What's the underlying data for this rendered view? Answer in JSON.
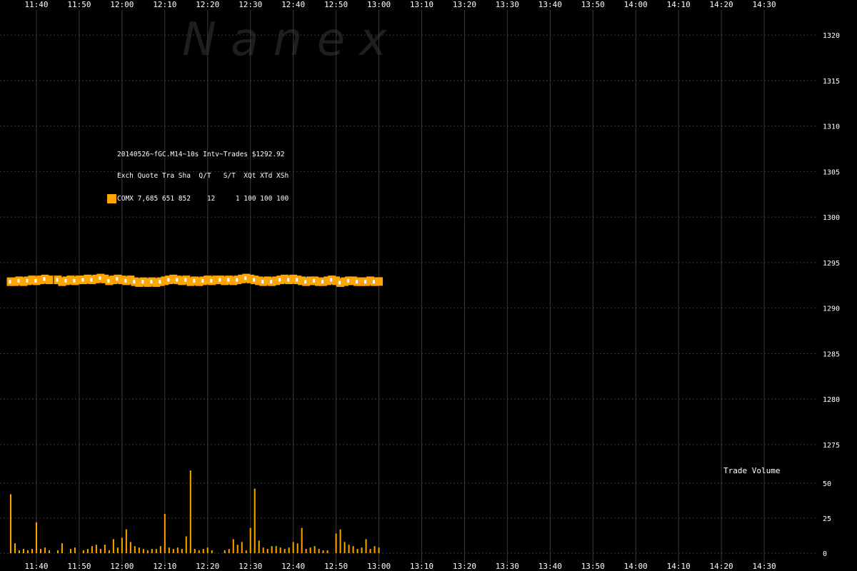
{
  "watermark": "N  a  n  e  x",
  "legend": {
    "line1": "20140526~fGC.M14~10s Intv~Trades $1292.92",
    "line2": "Exch Quote Tra Sha  Q/T   S/T  XQt XTd XSh",
    "line3": "COMX 7,685 651 852    12     1 100 100 100",
    "swatch_color": "#FFA500"
  },
  "volume_label": "Trade Volume",
  "colors": {
    "background": "#000000",
    "grid": "#3a3a3a",
    "price": "#FFA500",
    "price_marker": "#FFFFFF",
    "volume": "#FFA500"
  },
  "chart_data": [
    {
      "type": "scatter",
      "title": "",
      "x_ticks": [
        "11:40",
        "11:50",
        "12:00",
        "12:10",
        "12:20",
        "12:30",
        "12:40",
        "12:50",
        "13:00",
        "13:10",
        "13:20",
        "13:30",
        "13:40",
        "13:50",
        "14:00",
        "14:10",
        "14:20",
        "14:30"
      ],
      "x_range": [
        "11:34",
        "14:36"
      ],
      "y_ticks": [
        1275,
        1280,
        1285,
        1290,
        1295,
        1300,
        1305,
        1310,
        1315,
        1320
      ],
      "y_range": [
        1273.5,
        1321.5
      ],
      "grid": true,
      "series": [
        {
          "name": "COMX",
          "points": [
            [
              "11:34",
              1292.9
            ],
            [
              "11:35",
              1292.9
            ],
            [
              "11:36",
              1293.0
            ],
            [
              "11:37",
              1292.9
            ],
            [
              "11:38",
              1293.0
            ],
            [
              "11:39",
              1293.1
            ],
            [
              "11:40",
              1293.0
            ],
            [
              "11:41",
              1293.1
            ],
            [
              "11:42",
              1293.2
            ],
            [
              "11:43",
              1293.1
            ],
            [
              "11:45",
              1293.1
            ],
            [
              "11:46",
              1292.9
            ],
            [
              "11:47",
              1293.0
            ],
            [
              "11:48",
              1293.1
            ],
            [
              "11:49",
              1293.0
            ],
            [
              "11:50",
              1293.1
            ],
            [
              "11:51",
              1293.1
            ],
            [
              "11:52",
              1293.2
            ],
            [
              "11:53",
              1293.1
            ],
            [
              "11:54",
              1293.2
            ],
            [
              "11:55",
              1293.3
            ],
            [
              "11:56",
              1293.2
            ],
            [
              "11:57",
              1293.0
            ],
            [
              "11:58",
              1293.1
            ],
            [
              "11:59",
              1293.2
            ],
            [
              "12:00",
              1293.1
            ],
            [
              "12:01",
              1293.0
            ],
            [
              "12:02",
              1293.1
            ],
            [
              "12:03",
              1292.9
            ],
            [
              "12:04",
              1292.8
            ],
            [
              "12:05",
              1292.9
            ],
            [
              "12:06",
              1292.8
            ],
            [
              "12:07",
              1292.9
            ],
            [
              "12:08",
              1292.8
            ],
            [
              "12:09",
              1292.9
            ],
            [
              "12:10",
              1293.0
            ],
            [
              "12:11",
              1293.1
            ],
            [
              "12:12",
              1293.2
            ],
            [
              "12:13",
              1293.1
            ],
            [
              "12:14",
              1293.0
            ],
            [
              "12:15",
              1293.1
            ],
            [
              "12:16",
              1292.9
            ],
            [
              "12:17",
              1293.0
            ],
            [
              "12:18",
              1292.9
            ],
            [
              "12:19",
              1293.0
            ],
            [
              "12:20",
              1293.1
            ],
            [
              "12:21",
              1293.0
            ],
            [
              "12:22",
              1293.1
            ],
            [
              "12:23",
              1293.1
            ],
            [
              "12:24",
              1293.0
            ],
            [
              "12:25",
              1293.1
            ],
            [
              "12:26",
              1293.0
            ],
            [
              "12:27",
              1293.1
            ],
            [
              "12:28",
              1293.2
            ],
            [
              "12:29",
              1293.3
            ],
            [
              "12:30",
              1293.2
            ],
            [
              "12:31",
              1293.1
            ],
            [
              "12:32",
              1293.0
            ],
            [
              "12:33",
              1292.9
            ],
            [
              "12:34",
              1293.0
            ],
            [
              "12:35",
              1292.9
            ],
            [
              "12:36",
              1293.0
            ],
            [
              "12:37",
              1293.1
            ],
            [
              "12:38",
              1293.2
            ],
            [
              "12:39",
              1293.1
            ],
            [
              "12:40",
              1293.2
            ],
            [
              "12:41",
              1293.1
            ],
            [
              "12:42",
              1293.0
            ],
            [
              "12:43",
              1292.9
            ],
            [
              "12:44",
              1293.0
            ],
            [
              "12:45",
              1293.0
            ],
            [
              "12:46",
              1292.9
            ],
            [
              "12:47",
              1292.9
            ],
            [
              "12:48",
              1293.0
            ],
            [
              "12:49",
              1293.1
            ],
            [
              "12:50",
              1293.0
            ],
            [
              "12:51",
              1292.8
            ],
            [
              "12:52",
              1292.9
            ],
            [
              "12:53",
              1293.0
            ],
            [
              "12:54",
              1293.0
            ],
            [
              "12:55",
              1292.9
            ],
            [
              "12:56",
              1292.9
            ],
            [
              "12:57",
              1292.9
            ],
            [
              "12:58",
              1293.0
            ],
            [
              "12:59",
              1292.9
            ],
            [
              "13:00",
              1292.92
            ]
          ]
        }
      ]
    },
    {
      "type": "bar",
      "title": "Trade Volume",
      "y_ticks": [
        0,
        25,
        50
      ],
      "y_range": [
        0,
        55
      ],
      "bars": [
        [
          "11:34",
          42
        ],
        [
          "11:35",
          7
        ],
        [
          "11:36",
          2
        ],
        [
          "11:37",
          3
        ],
        [
          "11:38",
          2
        ],
        [
          "11:39",
          3
        ],
        [
          "11:40",
          22
        ],
        [
          "11:41",
          3
        ],
        [
          "11:42",
          4
        ],
        [
          "11:43",
          2
        ],
        [
          "11:45",
          2
        ],
        [
          "11:46",
          7
        ],
        [
          "11:48",
          3
        ],
        [
          "11:49",
          4
        ],
        [
          "11:51",
          2
        ],
        [
          "11:52",
          3
        ],
        [
          "11:53",
          5
        ],
        [
          "11:54",
          6
        ],
        [
          "11:55",
          3
        ],
        [
          "11:56",
          6
        ],
        [
          "11:57",
          2
        ],
        [
          "11:58",
          10
        ],
        [
          "11:59",
          4
        ],
        [
          "12:00",
          11
        ],
        [
          "12:01",
          17
        ],
        [
          "12:02",
          8
        ],
        [
          "12:03",
          5
        ],
        [
          "12:04",
          4
        ],
        [
          "12:05",
          3
        ],
        [
          "12:06",
          2
        ],
        [
          "12:07",
          3
        ],
        [
          "12:08",
          3
        ],
        [
          "12:09",
          5
        ],
        [
          "12:10",
          28
        ],
        [
          "12:11",
          4
        ],
        [
          "12:12",
          3
        ],
        [
          "12:13",
          4
        ],
        [
          "12:14",
          3
        ],
        [
          "12:15",
          12
        ],
        [
          "12:16",
          59
        ],
        [
          "12:17",
          3
        ],
        [
          "12:18",
          2
        ],
        [
          "12:19",
          3
        ],
        [
          "12:20",
          4
        ],
        [
          "12:21",
          2
        ],
        [
          "12:24",
          2
        ],
        [
          "12:25",
          3
        ],
        [
          "12:26",
          10
        ],
        [
          "12:27",
          6
        ],
        [
          "12:28",
          8
        ],
        [
          "12:29",
          2
        ],
        [
          "12:30",
          18
        ],
        [
          "12:31",
          46
        ],
        [
          "12:32",
          9
        ],
        [
          "12:33",
          4
        ],
        [
          "12:34",
          3
        ],
        [
          "12:35",
          5
        ],
        [
          "12:36",
          5
        ],
        [
          "12:37",
          4
        ],
        [
          "12:38",
          3
        ],
        [
          "12:39",
          4
        ],
        [
          "12:40",
          8
        ],
        [
          "12:41",
          7
        ],
        [
          "12:42",
          18
        ],
        [
          "12:43",
          3
        ],
        [
          "12:44",
          4
        ],
        [
          "12:45",
          5
        ],
        [
          "12:46",
          3
        ],
        [
          "12:47",
          2
        ],
        [
          "12:48",
          2
        ],
        [
          "12:50",
          14
        ],
        [
          "12:51",
          17
        ],
        [
          "12:52",
          8
        ],
        [
          "12:53",
          6
        ],
        [
          "12:54",
          5
        ],
        [
          "12:55",
          3
        ],
        [
          "12:56",
          4
        ],
        [
          "12:57",
          10
        ],
        [
          "12:58",
          3
        ],
        [
          "12:59",
          5
        ],
        [
          "13:00",
          4
        ]
      ]
    }
  ]
}
